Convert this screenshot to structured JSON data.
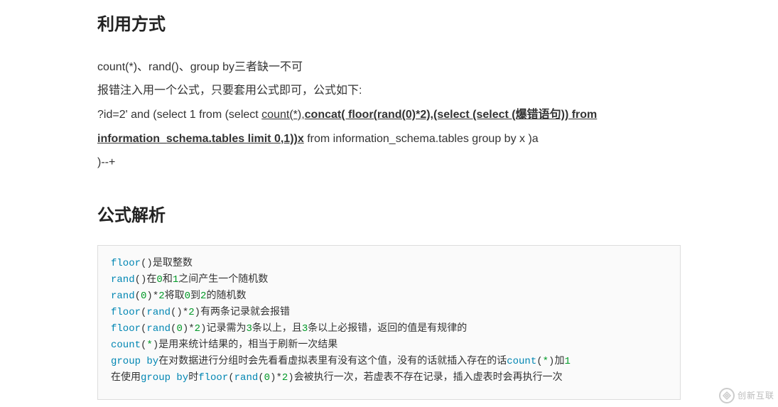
{
  "headings": {
    "usage": "利用方式",
    "analysis": "公式解析"
  },
  "paragraphs": {
    "p1": "count(*)、rand()、group by三者缺一不可",
    "p2": "报错注入用一个公式，只要套用公式即可，公式如下:",
    "p3_prefix": "?id=2' and (select 1 from (select ",
    "p3_u1": "count(*)",
    "p3_comma": ",",
    "p3_u2_bold": "concat( floor(rand(0)*2),(select (select (爆错语句)) from information_schema.tables limit 0,1))x",
    "p3_suffix": " from information_schema.tables group by x )a",
    "p4": ")--+"
  },
  "code": {
    "l1": {
      "kw": "floor",
      "rest": "()是取整数"
    },
    "l2": {
      "kw": "rand",
      "mid1": "()在",
      "n1": "0",
      "mid2": "和",
      "n2": "1",
      "rest": "之间产生一个随机数"
    },
    "l3": {
      "kw": "rand",
      "p1": "(",
      "n1": "0",
      "p2": ")*",
      "n2": "2",
      "mid": "将取",
      "n3": "0",
      "mid2": "到",
      "n4": "2",
      "rest": "的随机数"
    },
    "l4": {
      "kw1": "floor",
      "p1": "(",
      "kw2": "rand",
      "p2": "()*",
      "n1": "2",
      "p3": ")",
      "rest": "有两条记录就会报错"
    },
    "l5": {
      "kw1": "floor",
      "p1": "(",
      "kw2": "rand",
      "p2": "(",
      "n1": "0",
      "p3": ")*",
      "n2": "2",
      "p4": ")",
      "mid1": "记录需为",
      "n3": "3",
      "mid2": "条以上，且",
      "n4": "3",
      "rest": "条以上必报错，返回的值是有规律的"
    },
    "l6": {
      "kw": "count",
      "p1": "(",
      "star": "*",
      "p2": ")",
      "rest": "是用来统计结果的，相当于刷新一次结果"
    },
    "l7": {
      "kw": "group by",
      "mid": "在对数据进行分组时会先看看虚拟表里有没有这个值，没有的话就插入存在的话",
      "kw2": "count",
      "p1": "(",
      "star": "*",
      "p2": ")",
      "mid2": "加",
      "n1": "1"
    },
    "l8": {
      "pre": "在使用",
      "kw1": "group by",
      "mid1": "时",
      "kw2": "floor",
      "p1": "(",
      "kw3": "rand",
      "p2": "(",
      "n1": "0",
      "p3": ")*",
      "n2": "2",
      "p4": ")",
      "rest": "会被执行一次，若虚表不存在记录，插入虚表时会再执行一次"
    }
  },
  "watermark": "创新互联"
}
